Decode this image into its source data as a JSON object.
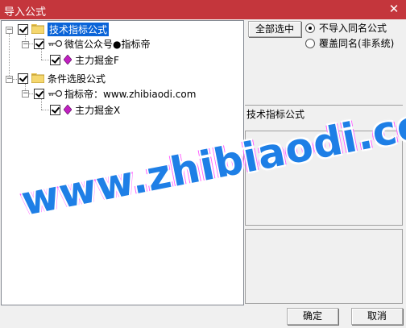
{
  "window": {
    "title": "导入公式",
    "close_glyph": "✕"
  },
  "tree": {
    "nodes": [
      {
        "label": "技术指标公式",
        "icon": "folder-icon",
        "checked": true,
        "expanded": true,
        "selected": true
      },
      {
        "label": "微信公众号●指标帝",
        "icon": "key-icon",
        "checked": true,
        "expanded": true
      },
      {
        "label": "主力掘金F",
        "icon": "formula-gem-icon",
        "checked": true
      },
      {
        "label": "条件选股公式",
        "icon": "folder-icon",
        "checked": true,
        "expanded": true
      },
      {
        "label": "指标帝：www.zhibiaodi.com",
        "icon": "key-icon",
        "checked": true,
        "expanded": true
      },
      {
        "label": "主力掘金X",
        "icon": "formula-gem-icon",
        "checked": true
      }
    ]
  },
  "options": {
    "select_all_label": "全部选中",
    "radio_no_import": "不导入同名公式",
    "radio_overwrite": "覆盖同名(非系统)",
    "selected": "no_import"
  },
  "info": {
    "header": "技术指标公式"
  },
  "footer": {
    "ok_label": "确定",
    "cancel_label": "取消"
  },
  "watermark": {
    "text": "www.zhibiaodi.com"
  },
  "colors": {
    "titlebar": "#c4363c",
    "selection": "#0a64d8",
    "watermark": "#1e7fe6"
  }
}
